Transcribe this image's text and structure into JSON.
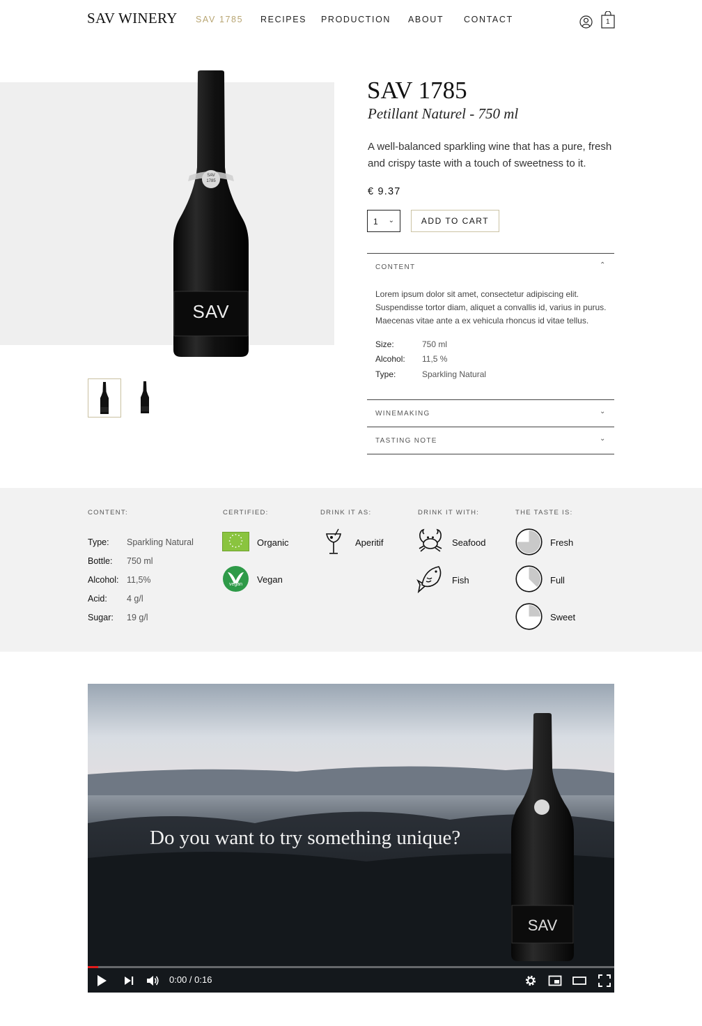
{
  "header": {
    "logo": "SAV WINERY",
    "nav": [
      "SAV 1785",
      "RECIPES",
      "PRODUCTION",
      "ABOUT",
      "CONTACT"
    ],
    "active_nav": "SAV 1785",
    "cart_count": "1",
    "accent_color": "#b8a572"
  },
  "gallery": {
    "bottle_label": "SAV",
    "bottle_badge_line1": "SAV",
    "bottle_badge_line2": "1785"
  },
  "product": {
    "title": "SAV 1785",
    "subtitle": "Petillant Naturel - 750 ml",
    "description": "A well-balanced sparkling wine that has a pure, fresh and crispy taste with a touch of sweetness to it.",
    "price": "€ 9.37",
    "quantity": "1",
    "add_to_cart": "ADD TO CART"
  },
  "accordion": {
    "content_title": "CONTENT",
    "content_body": "Lorem ipsum dolor sit amet, consectetur adipiscing elit. Suspendisse tortor diam, aliquet a convallis id, varius in purus. Maecenas vitae ante a ex vehicula rhoncus id vitae tellus.",
    "specs": [
      {
        "label": "Size:",
        "value": "750 ml"
      },
      {
        "label": "Alcohol:",
        "value": "11,5 %"
      },
      {
        "label": "Type:",
        "value": "Sparkling Natural"
      }
    ],
    "winemaking_title": "WINEMAKING",
    "tasting_title": "TASTING NOTE"
  },
  "details": {
    "content_heading": "CONTENT:",
    "content_rows": [
      {
        "label": "Type:",
        "value": "Sparkling Natural"
      },
      {
        "label": "Bottle:",
        "value": "750 ml"
      },
      {
        "label": "Alcohol:",
        "value": "11,5%"
      },
      {
        "label": "Acid:",
        "value": "4 g/l"
      },
      {
        "label": "Sugar:",
        "value": "19 g/l"
      }
    ],
    "certified_heading": "CERTIFIED:",
    "certified": [
      "Organic",
      "Vegan"
    ],
    "vegan_badge_text": "vegan",
    "drink_as_heading": "DRINK IT AS:",
    "drink_as": [
      "Aperitif"
    ],
    "drink_with_heading": "DRINK IT WITH:",
    "drink_with": [
      "Seafood",
      "Fish"
    ],
    "taste_heading": "THE TASTE IS:",
    "taste": [
      {
        "label": "Fresh",
        "level": 0.75
      },
      {
        "label": "Full",
        "level": 0.375
      },
      {
        "label": "Sweet",
        "level": 0.25
      }
    ]
  },
  "video": {
    "caption": "Do you want to try something unique?",
    "time": "0:00 / 0:16",
    "progress": 0.02,
    "bottle_label": "SAV"
  }
}
